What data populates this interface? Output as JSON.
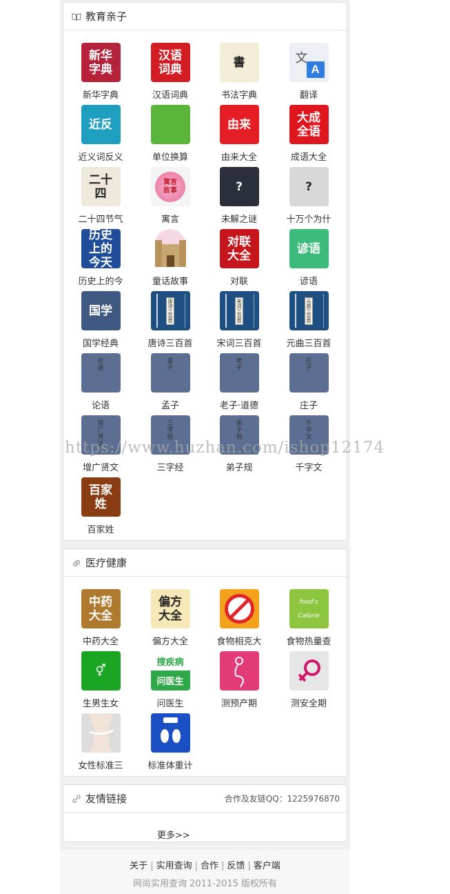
{
  "education": {
    "title": "教育亲子",
    "items": [
      {
        "label": "新华字典",
        "icon_text": "新华字典"
      },
      {
        "label": "汉语词典",
        "icon_text": "汉语词典"
      },
      {
        "label": "书法字典",
        "icon_text": "書"
      },
      {
        "label": "翻译",
        "icon_text": "文A"
      },
      {
        "label": "近义词反义",
        "icon_text": "近反"
      },
      {
        "label": "单位换算",
        "icon_text": ""
      },
      {
        "label": "由来大全",
        "icon_text": "由来"
      },
      {
        "label": "成语大全",
        "icon_text": "大成全语"
      },
      {
        "label": "二十四节气",
        "icon_text": "二十四"
      },
      {
        "label": "寓言",
        "icon_text": "寓言故事"
      },
      {
        "label": "未解之谜",
        "icon_text": "?"
      },
      {
        "label": "十万个为什",
        "icon_text": "?"
      },
      {
        "label": "历史上的今",
        "icon_text": "历史上的今天"
      },
      {
        "label": "童话故事",
        "icon_text": ""
      },
      {
        "label": "对联",
        "icon_text": "对联大全"
      },
      {
        "label": "谚语",
        "icon_text": "谚语"
      },
      {
        "label": "国学经典",
        "icon_text": "国学"
      },
      {
        "label": "唐诗三百首",
        "icon_text": "唐诗三百首"
      },
      {
        "label": "宋词三百首",
        "icon_text": "宋词三百首"
      },
      {
        "label": "元曲三百首",
        "icon_text": "元曲三百首"
      },
      {
        "label": "论语",
        "icon_text": "论语"
      },
      {
        "label": "孟子",
        "icon_text": "孟子"
      },
      {
        "label": "老子·道德",
        "icon_text": "老子"
      },
      {
        "label": "庄子",
        "icon_text": "庄子"
      },
      {
        "label": "增广贤文",
        "icon_text": "增广贤文"
      },
      {
        "label": "三字经",
        "icon_text": "三字经"
      },
      {
        "label": "弟子规",
        "icon_text": "弟子规"
      },
      {
        "label": "千字文",
        "icon_text": "千字文"
      },
      {
        "label": "百家姓",
        "icon_text": "百家姓"
      }
    ]
  },
  "health": {
    "title": "医疗健康",
    "items": [
      {
        "label": "中药大全",
        "icon_text": "中药大全"
      },
      {
        "label": "偏方大全",
        "icon_text": "偏方大全"
      },
      {
        "label": "食物相克大",
        "icon_text": ""
      },
      {
        "label": "食物热量查",
        "icon_text": "food's Calorie"
      },
      {
        "label": "生男生女",
        "icon_text": "⚥"
      },
      {
        "label": "问医生",
        "icon_text": "搜疾病 问医生"
      },
      {
        "label": "测预产期",
        "icon_text": ""
      },
      {
        "label": "测安全期",
        "icon_text": ""
      },
      {
        "label": "女性标准三",
        "icon_text": ""
      },
      {
        "label": "标准体重计",
        "icon_text": ""
      }
    ]
  },
  "links": {
    "title": "友情链接",
    "contact": "合作及友链QQ：1225976870",
    "more": "更多>>"
  },
  "footer": {
    "nav": [
      "关于",
      "实用查询",
      "合作",
      "反馈",
      "客户端"
    ],
    "copyright": "网尚实用查询 2011-2015 版权所有"
  },
  "watermark": "https://www.huzhan.com/ishop12174"
}
